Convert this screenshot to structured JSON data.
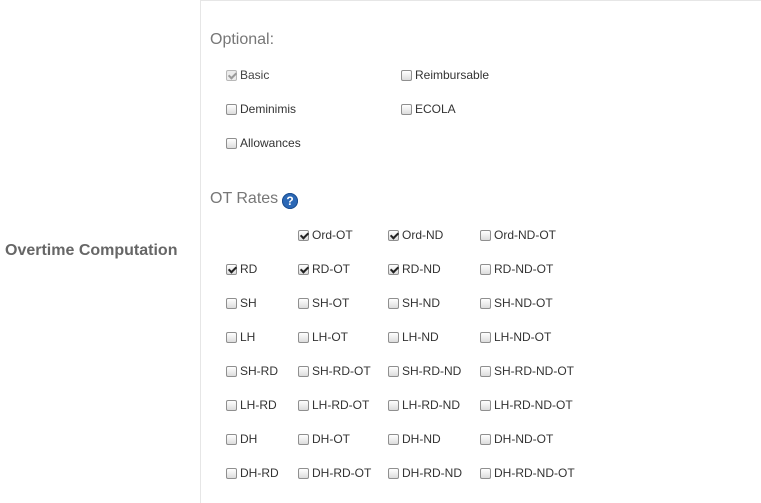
{
  "row_label": "Overtime Computation",
  "optional": {
    "title": "Optional:",
    "items": [
      {
        "label": "Basic",
        "checked": true,
        "disabled": true
      },
      {
        "label": "Reimbursable",
        "checked": false,
        "disabled": false
      },
      {
        "label": "Deminimis",
        "checked": false,
        "disabled": false
      },
      {
        "label": "ECOLA",
        "checked": false,
        "disabled": false
      },
      {
        "label": "Allowances",
        "checked": false,
        "disabled": false
      }
    ]
  },
  "ot_rates": {
    "title": "OT Rates",
    "help_icon": "question-circle-icon",
    "rows": [
      [
        null,
        {
          "label": "Ord-OT",
          "checked": true
        },
        {
          "label": "Ord-ND",
          "checked": true
        },
        {
          "label": "Ord-ND-OT",
          "checked": false
        }
      ],
      [
        {
          "label": "RD",
          "checked": true
        },
        {
          "label": "RD-OT",
          "checked": true
        },
        {
          "label": "RD-ND",
          "checked": true
        },
        {
          "label": "RD-ND-OT",
          "checked": false
        }
      ],
      [
        {
          "label": "SH",
          "checked": false
        },
        {
          "label": "SH-OT",
          "checked": false
        },
        {
          "label": "SH-ND",
          "checked": false
        },
        {
          "label": "SH-ND-OT",
          "checked": false
        }
      ],
      [
        {
          "label": "LH",
          "checked": false
        },
        {
          "label": "LH-OT",
          "checked": false
        },
        {
          "label": "LH-ND",
          "checked": false
        },
        {
          "label": "LH-ND-OT",
          "checked": false
        }
      ],
      [
        {
          "label": "SH-RD",
          "checked": false
        },
        {
          "label": "SH-RD-OT",
          "checked": false
        },
        {
          "label": "SH-RD-ND",
          "checked": false
        },
        {
          "label": "SH-RD-ND-OT",
          "checked": false
        }
      ],
      [
        {
          "label": "LH-RD",
          "checked": false
        },
        {
          "label": "LH-RD-OT",
          "checked": false
        },
        {
          "label": "LH-RD-ND",
          "checked": false
        },
        {
          "label": "LH-RD-ND-OT",
          "checked": false
        }
      ],
      [
        {
          "label": "DH",
          "checked": false
        },
        {
          "label": "DH-OT",
          "checked": false
        },
        {
          "label": "DH-ND",
          "checked": false
        },
        {
          "label": "DH-ND-OT",
          "checked": false
        }
      ],
      [
        {
          "label": "DH-RD",
          "checked": false
        },
        {
          "label": "DH-RD-OT",
          "checked": false
        },
        {
          "label": "DH-RD-ND",
          "checked": false
        },
        {
          "label": "DH-RD-ND-OT",
          "checked": false
        }
      ]
    ]
  },
  "colors": {
    "help_icon": "#2b68b6",
    "label": "#666666"
  }
}
